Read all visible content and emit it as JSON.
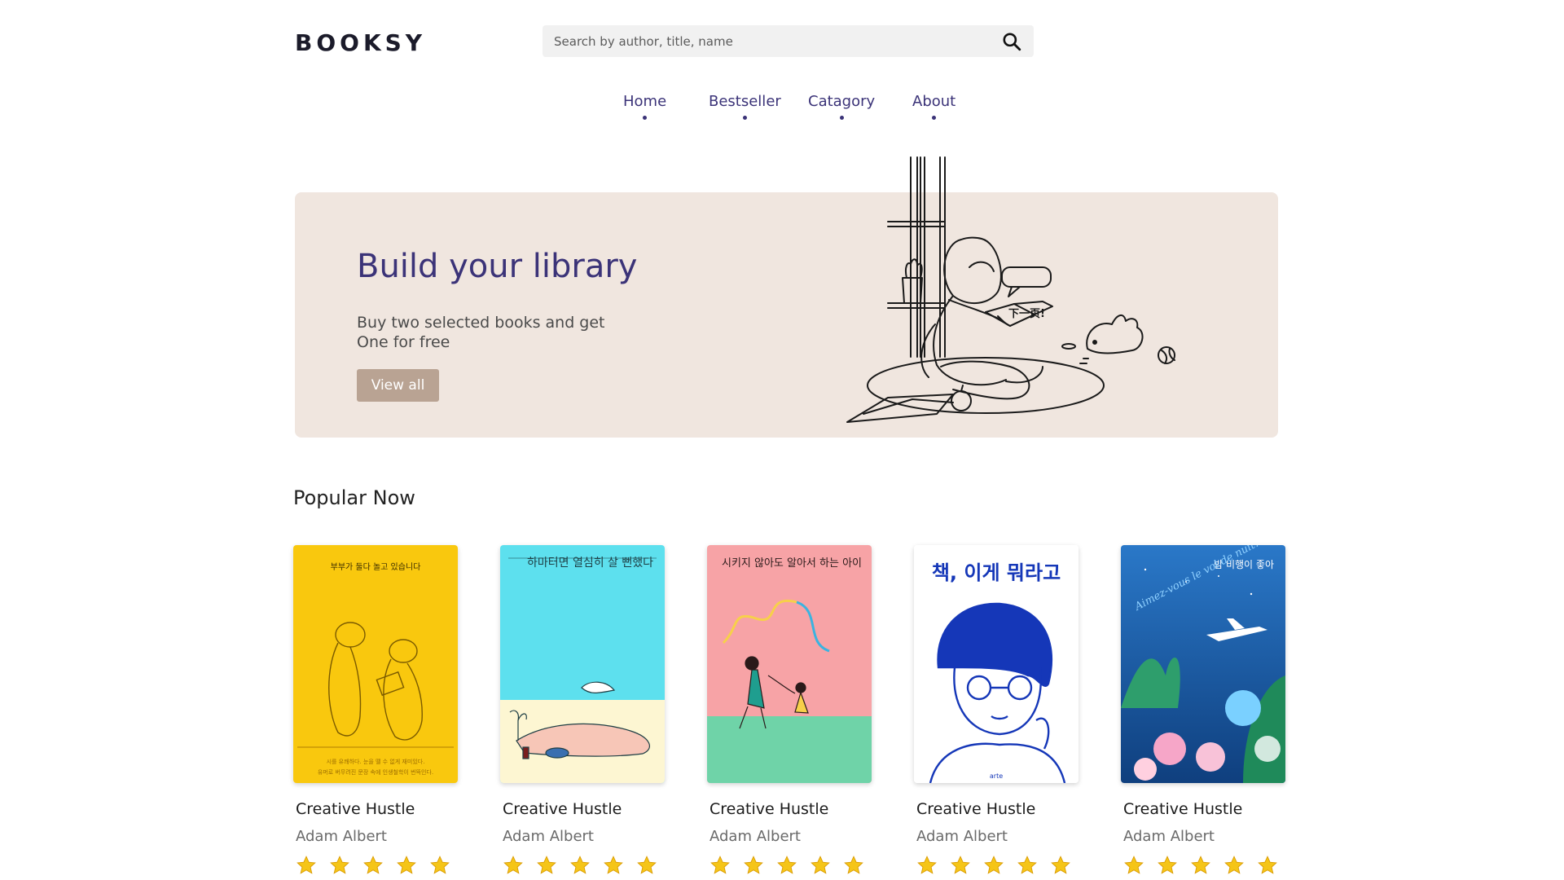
{
  "brand": {
    "logo": "BOOKSY"
  },
  "search": {
    "placeholder": "Search by author, title, name",
    "icon": "search-icon"
  },
  "nav": [
    {
      "label": "Home"
    },
    {
      "label": "Bestseller"
    },
    {
      "label": "Catagory"
    },
    {
      "label": "About"
    }
  ],
  "hero": {
    "title": "Build your library",
    "subtitle_line1": "Buy two selected books and get",
    "subtitle_line2": "One for free",
    "button": "View all",
    "speech": "下一页!"
  },
  "popular": {
    "title": "Popular Now",
    "books": [
      {
        "title": "Creative Hustle",
        "author": "Adam Albert",
        "rating": 5,
        "cover_text": "부부가 둘다 놀고 있습니다",
        "cover_color": "#f9c80e"
      },
      {
        "title": "Creative Hustle",
        "author": "Adam Albert",
        "rating": 5,
        "cover_text": "하마터면 열심히 살 뻔했다",
        "cover_color": "#5de0ee"
      },
      {
        "title": "Creative Hustle",
        "author": "Adam Albert",
        "rating": 5,
        "cover_text": "시키지 않아도 알아서 하는 아이",
        "cover_color": "#f7a3a6"
      },
      {
        "title": "Creative Hustle",
        "author": "Adam Albert",
        "rating": 5,
        "cover_text": "책, 이게 뭐라고",
        "cover_color": "#ffffff"
      },
      {
        "title": "Creative Hustle",
        "author": "Adam Albert",
        "rating": 5,
        "cover_text": "밤 비행이 좋아",
        "cover_color": "#1e6fb8"
      }
    ]
  },
  "colors": {
    "accent": "#3b3378",
    "hero_bg": "#f0e6df",
    "button": "#b9a393",
    "star": "#f5c518"
  }
}
